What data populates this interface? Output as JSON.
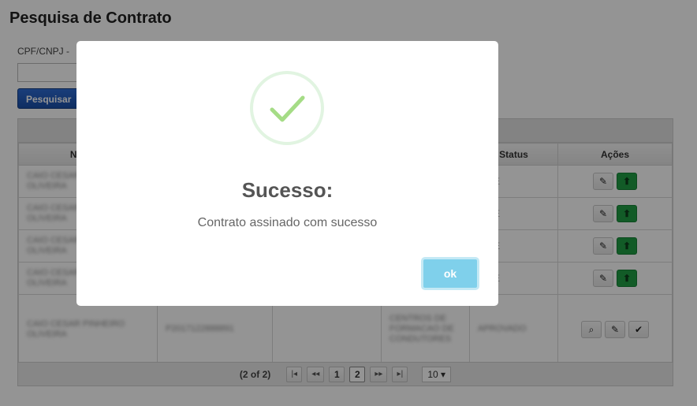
{
  "page": {
    "title": "Pesquisa de Contrato",
    "filter_label": "CPF/CNPJ -",
    "search_button": "Pesquisar"
  },
  "table": {
    "columns": [
      "Nome/R",
      "",
      "",
      "",
      "Status",
      "Ações"
    ],
    "rows": [
      {
        "name": "CAIO CESAR PINHEIRO OLIVEIRA",
        "status": "ENTE"
      },
      {
        "name": "CAIO CESAR PINHEIRO OLIVEIRA",
        "status": "ENTE"
      },
      {
        "name": "CAIO CESAR PINHEIRO OLIVEIRA",
        "status": "ENTE"
      },
      {
        "name": "CAIO CESAR PINHEIRO OLIVEIRA",
        "status": "ENTE"
      },
      {
        "name": "CAIO CESAR PINHEIRO OLIVEIRA",
        "doc": "P2017122888891",
        "type": "CENTROS DE FORMACAO DE CONDUTORES",
        "status": "APROVADO"
      }
    ]
  },
  "pager": {
    "info": "(2 of 2)",
    "first": "|◂",
    "prev": "◂◂",
    "pages": [
      "1",
      "2"
    ],
    "next": "▸▸",
    "last": "▸|",
    "page_size": "10 ▾"
  },
  "modal": {
    "title": "Sucesso:",
    "message": "Contrato assinado com sucesso",
    "ok_label": "ok",
    "check_color": "#a5dc86",
    "ok_color": "#7fd0eb"
  },
  "icons": {
    "edit": "✎",
    "upload": "⬆",
    "search": "⌕",
    "check": "✔"
  }
}
